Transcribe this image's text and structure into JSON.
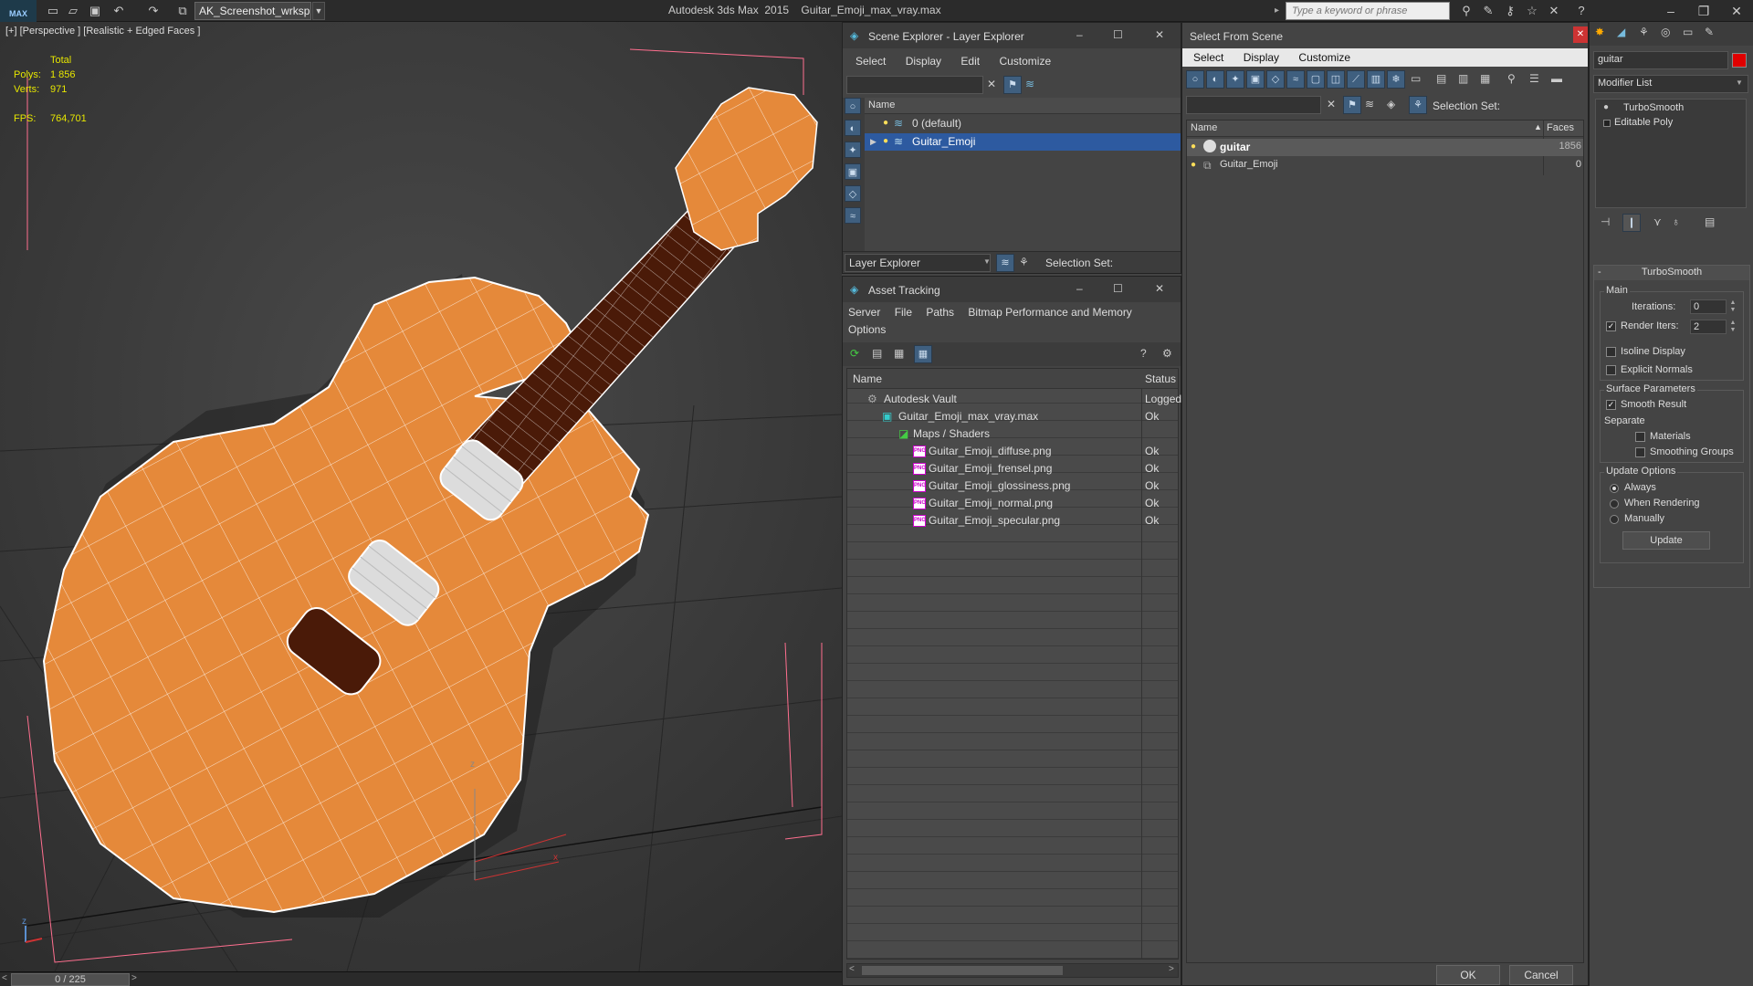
{
  "app": {
    "logo_text": "MAX",
    "workspace": "AK_Screenshot_wrksp",
    "title": "Autodesk 3ds Max  2015    Guitar_Emoji_max_vray.max",
    "search_placeholder": "Type a keyword or phrase"
  },
  "viewport": {
    "label": "[+] [Perspective ] [Realistic + Edged Faces ]",
    "stats": {
      "total_label": "Total",
      "polys_label": "Polys:",
      "polys_value": "1 856",
      "verts_label": "Verts:",
      "verts_value": "971",
      "fps_label": "FPS:",
      "fps_value": "764,701"
    },
    "axis_z": "z",
    "axis_x": "x"
  },
  "statusbar": {
    "time_slider": "0 / 225"
  },
  "scene_explorer": {
    "title": "Scene Explorer - Layer Explorer",
    "menu": [
      "Select",
      "Display",
      "Edit",
      "Customize"
    ],
    "column_name": "Name",
    "layers": [
      {
        "name": "0 (default)",
        "selected": false
      },
      {
        "name": "Guitar_Emoji",
        "selected": true
      }
    ],
    "footer_dropdown": "Layer Explorer",
    "footer_selection_set": "Selection Set:"
  },
  "asset_tracking": {
    "title": "Asset Tracking",
    "menu_row1": [
      "Server",
      "File",
      "Paths",
      "Bitmap Performance and Memory"
    ],
    "menu_row2": [
      "Options"
    ],
    "col_name": "Name",
    "col_status": "Status",
    "rows": [
      {
        "name": "Autodesk Vault",
        "status": "Logged",
        "indent": 0,
        "icon": "vault"
      },
      {
        "name": "Guitar_Emoji_max_vray.max",
        "status": "Ok",
        "indent": 1,
        "icon": "max"
      },
      {
        "name": "Maps / Shaders",
        "status": "",
        "indent": 2,
        "icon": "maps"
      },
      {
        "name": "Guitar_Emoji_diffuse.png",
        "status": "Ok",
        "indent": 3,
        "icon": "png"
      },
      {
        "name": "Guitar_Emoji_frensel.png",
        "status": "Ok",
        "indent": 3,
        "icon": "png"
      },
      {
        "name": "Guitar_Emoji_glossiness.png",
        "status": "Ok",
        "indent": 3,
        "icon": "png"
      },
      {
        "name": "Guitar_Emoji_normal.png",
        "status": "Ok",
        "indent": 3,
        "icon": "png"
      },
      {
        "name": "Guitar_Emoji_specular.png",
        "status": "Ok",
        "indent": 3,
        "icon": "png"
      }
    ],
    "png_icon_text": "PNG"
  },
  "select_from_scene": {
    "title": "Select From Scene",
    "menu": [
      "Select",
      "Display",
      "Customize"
    ],
    "selection_set_label": "Selection Set:",
    "col_name": "Name",
    "col_faces": "Faces",
    "rows": [
      {
        "name": "guitar",
        "faces": "1856",
        "highlighted": true
      },
      {
        "name": "Guitar_Emoji",
        "faces": "0",
        "highlighted": false
      }
    ],
    "ok_label": "OK",
    "cancel_label": "Cancel"
  },
  "command_panel": {
    "object_name": "guitar",
    "modifier_list": "Modifier List",
    "stack": [
      "TurboSmooth",
      "Editable Poly"
    ],
    "rollout_title": "TurboSmooth",
    "main_group": "Main",
    "iterations_label": "Iterations:",
    "iterations_value": "0",
    "render_iters_label": "Render Iters:",
    "render_iters_value": "2",
    "render_iters_checked": true,
    "isoline_label": "Isoline Display",
    "explicit_normals_label": "Explicit Normals",
    "surface_group": "Surface Parameters",
    "smooth_result_label": "Smooth Result",
    "separate_label": "Separate",
    "materials_label": "Materials",
    "smoothing_groups_label": "Smoothing Groups",
    "update_group": "Update Options",
    "always_label": "Always",
    "when_rendering_label": "When Rendering",
    "manually_label": "Manually",
    "update_button": "Update",
    "object_color": "#e00000"
  },
  "colors": {
    "guitar_body": "#e5893a",
    "fretboard": "#4a1a08",
    "pickup": "#e0e0e0",
    "selection": "#2d5aa0"
  }
}
